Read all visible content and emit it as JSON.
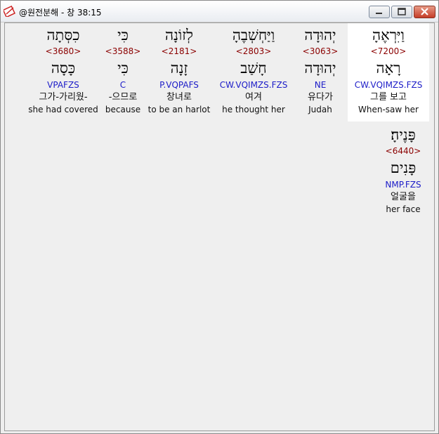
{
  "window": {
    "title": "@원전분해 - 창 38:15",
    "controls": {
      "minimize_icon": "minimize-icon",
      "maximize_icon": "maximize-icon",
      "close_icon": "close-icon",
      "close_color": "#c53d28"
    }
  },
  "accent": {
    "strong_color": "#8b0000",
    "parse_color": "#1c1cc8",
    "highlight": "#ffffff"
  },
  "words": [
    {
      "hebrew": "וַיִּרְאֶהָ",
      "strong": "<7200>",
      "lemma": "רָאָה",
      "parse": "CW.VQIMZS.FZS",
      "korean": "그를 보고",
      "english": "When-saw her"
    },
    {
      "hebrew": "יְהוּדָה",
      "strong": "<3063>",
      "lemma": "יְהוּדָה",
      "parse": "NE",
      "korean": "유다가",
      "english": "Judah"
    },
    {
      "hebrew": "וַיַּחְשְׁבֶהָ",
      "strong": "<2803>",
      "lemma": "חָשַׁב",
      "parse": "CW.VQIMZS.FZS",
      "korean": "여겨",
      "english": "he thought her"
    },
    {
      "hebrew": "לְזוֹנָה",
      "strong": "<2181>",
      "lemma": "זָנָה",
      "parse": "P.VQPAFS",
      "korean": "창녀로",
      "english": "to be an harlot"
    },
    {
      "hebrew": "כִּי",
      "strong": "<3588>",
      "lemma": "כִּי",
      "parse": "C",
      "korean": "-으므로",
      "english": "because"
    },
    {
      "hebrew": "כִסְּתָה",
      "strong": "<3680>",
      "lemma": "כָּסָה",
      "parse": "VPAFZS",
      "korean": "그가-가리웠-",
      "english": "she had covered"
    },
    {
      "hebrew": "פָּנֶיהָ׃",
      "strong": "<6440>",
      "lemma": "פָּנִים",
      "parse": "NMP.FZS",
      "korean": "얼굴을",
      "english": "her face"
    }
  ]
}
